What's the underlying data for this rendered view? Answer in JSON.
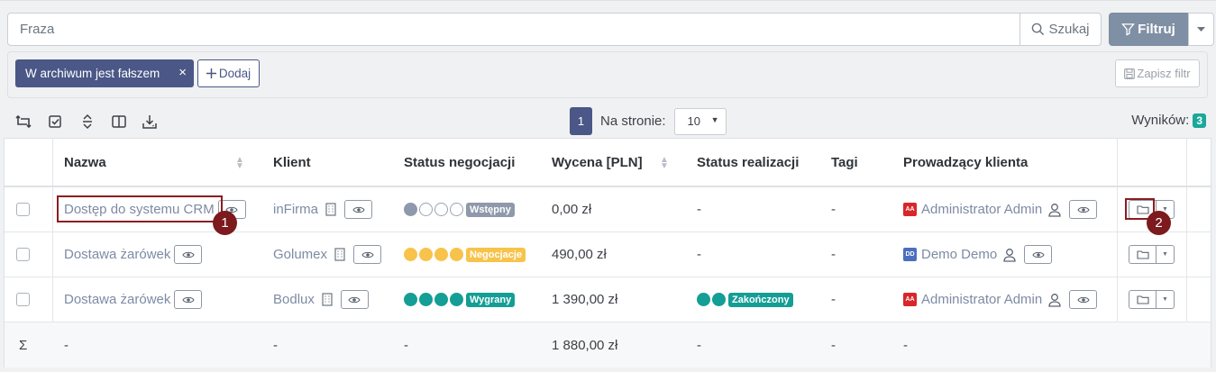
{
  "search": {
    "placeholder": "Fraza",
    "search_label": "Szukaj",
    "filter_label": "Filtruj"
  },
  "filters": {
    "chip_label": "W archiwum jest fałszem",
    "chip_close": "×",
    "add_label": "Dodaj",
    "save_label": "Zapisz filtr"
  },
  "toolbar": {
    "icons": [
      "rotate-arrows-icon",
      "check-square-icon",
      "expand-collapse-icon",
      "columns-icon",
      "download-icon"
    ],
    "current_page": "1",
    "per_page_label": "Na stronie:",
    "per_page_value": "10",
    "results_label": "Wyników:",
    "results_count": "3"
  },
  "table": {
    "columns": [
      "Nazwa",
      "Klient",
      "Status negocjacji",
      "Wycena [PLN]",
      "Status realizacji",
      "Tagi",
      "Prowadzący klienta"
    ],
    "rows": [
      {
        "name": "Dostęp do systemu CRM",
        "client": "inFirma",
        "neg_filled": 1,
        "neg_total": 4,
        "neg_status": "Wstępny",
        "neg_color": "#8e99ab",
        "price": "0,00 zł",
        "realization": "-",
        "real_filled": 0,
        "real_status": "",
        "real_color": "",
        "tags": "-",
        "owner_initials": "AA",
        "owner_color": "#d9262a",
        "owner": "Administrator Admin"
      },
      {
        "name": "Dostawa żarówek",
        "client": "Golumex",
        "neg_filled": 4,
        "neg_total": 4,
        "neg_status": "Negocjacje",
        "neg_color": "#f7c34a",
        "price": "490,00 zł",
        "realization": "-",
        "real_filled": 0,
        "real_status": "",
        "real_color": "",
        "tags": "-",
        "owner_initials": "DD",
        "owner_color": "#4a6fbf",
        "owner": "Demo Demo"
      },
      {
        "name": "Dostawa żarówek",
        "client": "Bodlux",
        "neg_filled": 4,
        "neg_total": 4,
        "neg_status": "Wygrany",
        "neg_color": "#149e95",
        "price": "1 390,00 zł",
        "realization": "",
        "real_filled": 2,
        "real_status": "Zakończony",
        "real_color": "#149e95",
        "tags": "-",
        "owner_initials": "AA",
        "owner_color": "#d9262a",
        "owner": "Administrator Admin"
      }
    ],
    "summary": {
      "symbol": "Σ",
      "name": "-",
      "client": "-",
      "neg": "-",
      "price": "1 880,00 zł",
      "realization": "-",
      "tags": "-",
      "owner": "-"
    }
  },
  "annotations": [
    "1",
    "2"
  ]
}
